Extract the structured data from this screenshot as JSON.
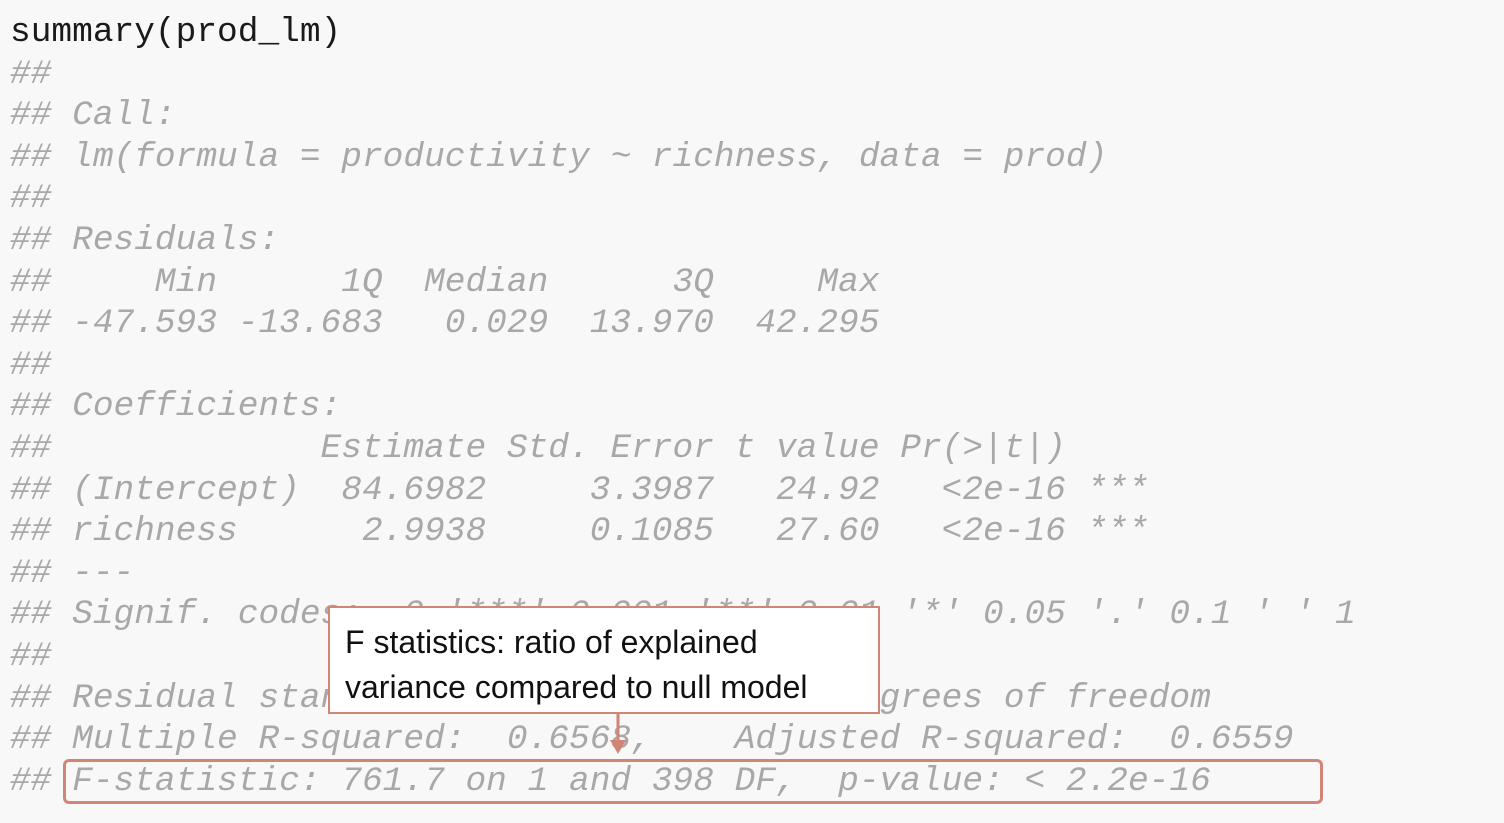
{
  "code": {
    "command": "summary(prod_lm)",
    "output_lines": [
      "##",
      "## Call:",
      "## lm(formula = productivity ~ richness, data = prod)",
      "##",
      "## Residuals:",
      "##     Min      1Q  Median      3Q     Max",
      "## -47.593 -13.683   0.029  13.970  42.295",
      "##",
      "## Coefficients:",
      "##             Estimate Std. Error t value Pr(>|t|)",
      "## (Intercept)  84.6982     3.3987   24.92   <2e-16 ***",
      "## richness      2.9938     0.1085   27.60   <2e-16 ***",
      "## ---",
      "## Signif. codes:  0 '***' 0.001 '**' 0.01 '*' 0.05 '.' 0.1 ' ' 1",
      "##",
      "## Residual standard error: 19.5 on 398 degrees of freedom",
      "## Multiple R-squared:  0.6568,    Adjusted R-squared:  0.6559",
      "## F-statistic: 761.7 on 1 and 398 DF,  p-value: < 2.2e-16"
    ]
  },
  "callout": {
    "line1": "F statistics: ratio of explained",
    "line2": "variance compared to null model"
  },
  "colors": {
    "highlight": "#d08575",
    "output_text": "#a8a8a8",
    "command_text": "#1a1a1a",
    "background": "#f8f8f8"
  }
}
